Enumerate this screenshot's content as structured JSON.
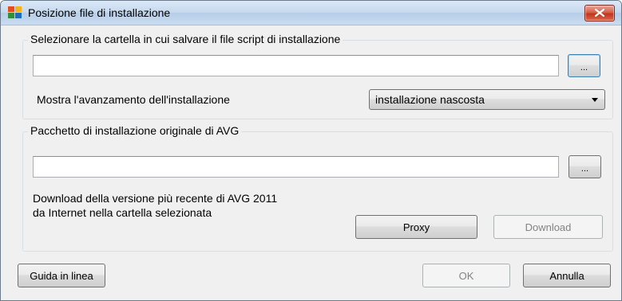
{
  "window": {
    "title": "Posizione file di installazione"
  },
  "script_group": {
    "title": "Selezionare la cartella in cui salvare il file script di installazione",
    "path_value": "",
    "browse_label": "...",
    "progress_label": "Mostra l'avanzamento dell'installazione",
    "progress_selected": "installazione nascosta"
  },
  "package_group": {
    "title": "Pacchetto di installazione originale di AVG",
    "path_value": "",
    "browse_label": "...",
    "download_info_line1": "Download della versione più recente di AVG 2011",
    "download_info_line2": "da Internet nella cartella selezionata",
    "proxy_label": "Proxy",
    "download_label": "Download"
  },
  "footer": {
    "help_label": "Guida in linea",
    "ok_label": "OK",
    "cancel_label": "Annulla"
  },
  "icons": {
    "app": "avg-logo-icon",
    "close": "close-icon",
    "dropdown": "chevron-down-icon"
  }
}
